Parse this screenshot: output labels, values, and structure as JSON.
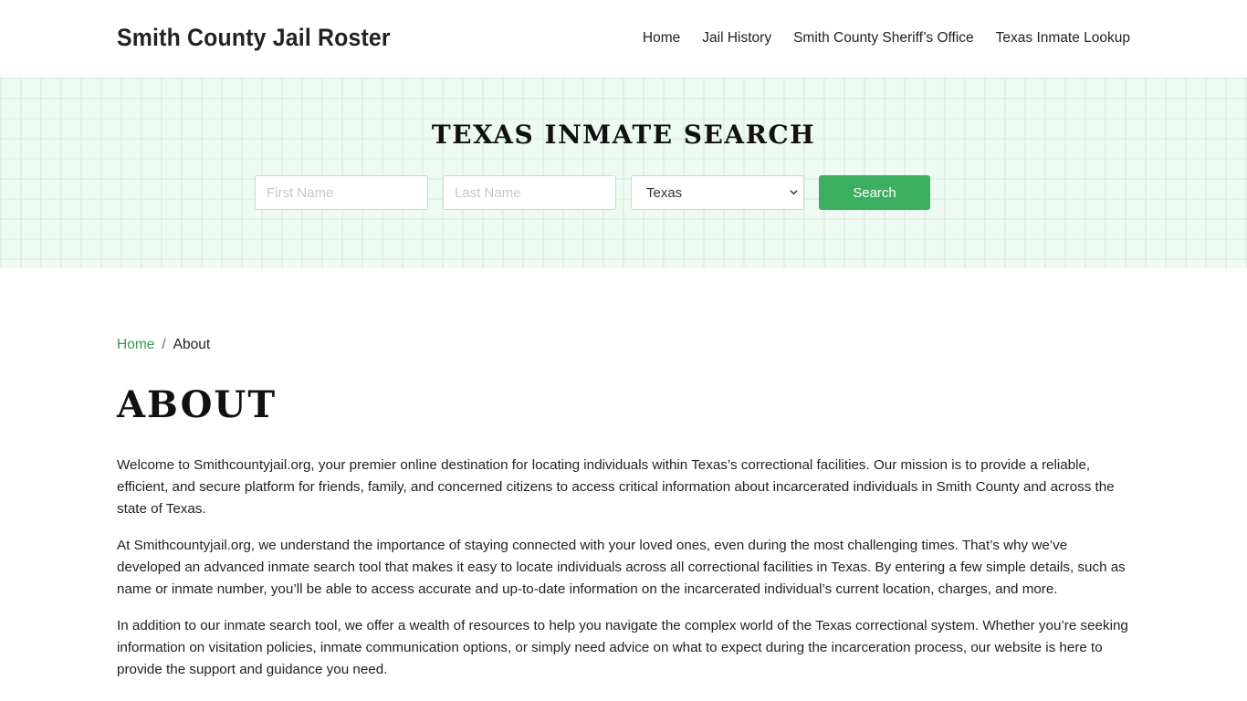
{
  "header": {
    "brand": "Smith County Jail Roster",
    "nav": [
      {
        "label": "Home"
      },
      {
        "label": "Jail History"
      },
      {
        "label": "Smith County Sheriff’s Office"
      },
      {
        "label": "Texas Inmate Lookup"
      }
    ]
  },
  "hero": {
    "title": "TEXAS INMATE SEARCH",
    "first_name_placeholder": "First Name",
    "last_name_placeholder": "Last Name",
    "state_selected": "Texas",
    "search_label": "Search"
  },
  "breadcrumb": {
    "home": "Home",
    "separator": "/",
    "current": "About"
  },
  "page": {
    "title": "ABOUT",
    "paragraphs": [
      "Welcome to Smithcountyjail.org, your premier online destination for locating individuals within Texas’s correctional facilities. Our mission is to provide a reliable, efficient, and secure platform for friends, family, and concerned citizens to access critical information about incarcerated individuals in Smith County and across the state of Texas.",
      "At Smithcountyjail.org, we understand the importance of staying connected with your loved ones, even during the most challenging times. That’s why we’ve developed an advanced inmate search tool that makes it easy to locate individuals across all correctional facilities in Texas. By entering a few simple details, such as name or inmate number, you’ll be able to access accurate and up-to-date information on the incarcerated individual’s current location, charges, and more.",
      "In addition to our inmate search tool, we offer a wealth of resources to help you navigate the complex world of the Texas correctional system. Whether you’re seeking information on visitation policies, inmate communication options, or simply need advice on what to expect during the incarceration process, our website is here to provide the support and guidance you need."
    ]
  },
  "colors": {
    "accent": "#3cae5f",
    "link": "#3a9a55",
    "hero_bg": "#eefaf2"
  }
}
